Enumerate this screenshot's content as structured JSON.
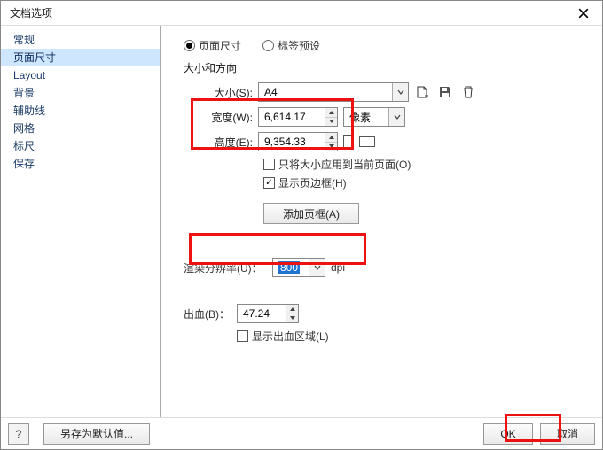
{
  "window": {
    "title": "文档选项"
  },
  "sidebar": {
    "items": [
      {
        "label": "常规"
      },
      {
        "label": "页面尺寸"
      },
      {
        "label": "Layout"
      },
      {
        "label": "背景"
      },
      {
        "label": "辅助线"
      },
      {
        "label": "网格"
      },
      {
        "label": "标尺"
      },
      {
        "label": "保存"
      }
    ],
    "selected_index": 1
  },
  "content": {
    "radio_page_size": "页面尺寸",
    "radio_label_preset": "标签预设",
    "size_orientation_heading": "大小和方向",
    "size_label": "大小(S):",
    "size_value": "A4",
    "width_label": "宽度(W):",
    "width_value": "6,614.17",
    "height_label": "高度(E):",
    "height_value": "9,354.33",
    "unit_value": "像素",
    "apply_only_current": "只将大小应用到当前页面(O)",
    "show_page_border": "显示页边框(H)",
    "add_frame_btn": "添加页框(A)",
    "render_res_label": "渲染分辨率(U)：",
    "render_res_value": "800",
    "render_res_unit": "dpi",
    "bleed_label": "出血(B)：",
    "bleed_value": "47.24",
    "show_bleed_area": "显示出血区域(L)"
  },
  "footer": {
    "help": "?",
    "save_defaults": "另存为默认值...",
    "ok": "OK",
    "cancel": "取消"
  },
  "icons": {
    "close": "close-icon",
    "chevron_down": "chevron-down-icon",
    "page_add": "page-add-icon",
    "save": "save-icon",
    "trash": "trash-icon"
  }
}
